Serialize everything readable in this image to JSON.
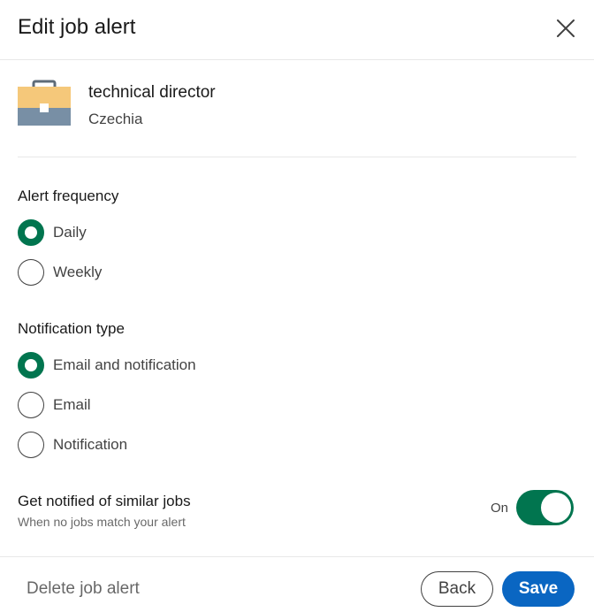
{
  "dialog": {
    "title": "Edit job alert",
    "close_icon": "close-icon"
  },
  "job": {
    "icon": "briefcase-icon",
    "title": "technical director",
    "location": "Czechia"
  },
  "alert_frequency": {
    "label": "Alert frequency",
    "options": [
      {
        "label": "Daily",
        "selected": true
      },
      {
        "label": "Weekly",
        "selected": false
      }
    ]
  },
  "notification_type": {
    "label": "Notification type",
    "options": [
      {
        "label": "Email and notification",
        "selected": true
      },
      {
        "label": "Email",
        "selected": false
      },
      {
        "label": "Notification",
        "selected": false
      }
    ]
  },
  "similar_jobs": {
    "title": "Get notified of similar jobs",
    "subtitle": "When no jobs match your alert",
    "toggle_label": "On",
    "enabled": true
  },
  "footer": {
    "delete_label": "Delete job alert",
    "back_label": "Back",
    "save_label": "Save"
  },
  "colors": {
    "accent_green": "#01754f",
    "primary_blue": "#0a66c2",
    "briefcase_top": "#f5c87a",
    "briefcase_bottom": "#788fa5"
  }
}
